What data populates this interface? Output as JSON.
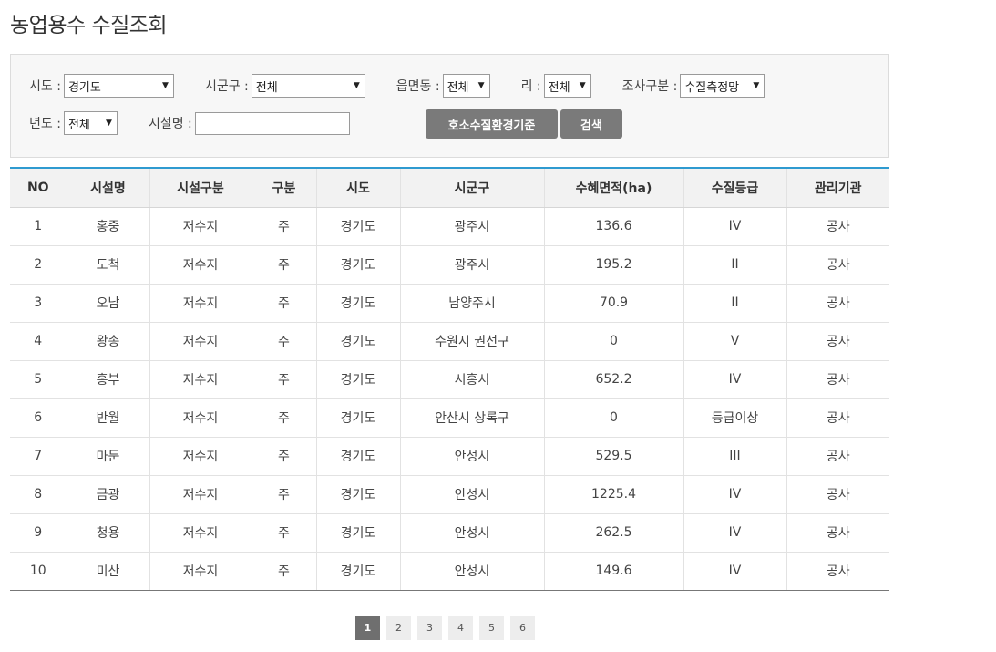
{
  "title": "농업용수 수질조회",
  "filters": {
    "sido_label": "시도 :",
    "sido_value": "경기도",
    "sigungu_label": "시군구 :",
    "sigungu_value": "전체",
    "eup_label": "읍면동 :",
    "eup_value": "전체",
    "ri_label": "리 :",
    "ri_value": "전체",
    "survey_label": "조사구분 :",
    "survey_value": "수질측정망",
    "year_label": "년도 :",
    "year_value": "전체",
    "facility_label": "시설명 :",
    "facility_value": "",
    "standard_button": "호소수질환경기준",
    "search_button": "검색"
  },
  "table": {
    "headers": [
      "NO",
      "시설명",
      "시설구분",
      "구분",
      "시도",
      "시군구",
      "수혜면적(ha)",
      "수질등급",
      "관리기관"
    ],
    "rows": [
      [
        "1",
        "홍중",
        "저수지",
        "주",
        "경기도",
        "광주시",
        "136.6",
        "IV",
        "공사"
      ],
      [
        "2",
        "도척",
        "저수지",
        "주",
        "경기도",
        "광주시",
        "195.2",
        "II",
        "공사"
      ],
      [
        "3",
        "오남",
        "저수지",
        "주",
        "경기도",
        "남양주시",
        "70.9",
        "II",
        "공사"
      ],
      [
        "4",
        "왕송",
        "저수지",
        "주",
        "경기도",
        "수원시 권선구",
        "0",
        "V",
        "공사"
      ],
      [
        "5",
        "흥부",
        "저수지",
        "주",
        "경기도",
        "시흥시",
        "652.2",
        "IV",
        "공사"
      ],
      [
        "6",
        "반월",
        "저수지",
        "주",
        "경기도",
        "안산시 상록구",
        "0",
        "등급이상",
        "공사"
      ],
      [
        "7",
        "마둔",
        "저수지",
        "주",
        "경기도",
        "안성시",
        "529.5",
        "III",
        "공사"
      ],
      [
        "8",
        "금광",
        "저수지",
        "주",
        "경기도",
        "안성시",
        "1225.4",
        "IV",
        "공사"
      ],
      [
        "9",
        "청용",
        "저수지",
        "주",
        "경기도",
        "안성시",
        "262.5",
        "IV",
        "공사"
      ],
      [
        "10",
        "미산",
        "저수지",
        "주",
        "경기도",
        "안성시",
        "149.6",
        "IV",
        "공사"
      ]
    ]
  },
  "pagination": {
    "pages": [
      "1",
      "2",
      "3",
      "4",
      "5",
      "6"
    ],
    "current": "1"
  },
  "colors": {
    "accent": "#2e9ad0",
    "button": "#7a7a7a",
    "active_page": "#6f6f6f"
  }
}
